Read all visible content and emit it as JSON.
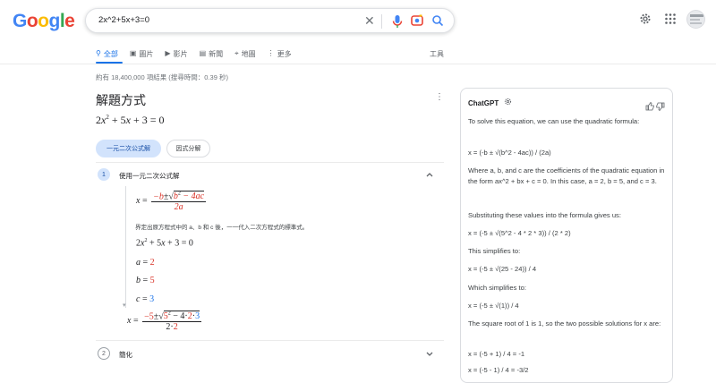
{
  "header": {
    "logo_text": "Google",
    "logo_colors": [
      "#4285F4",
      "#EA4335",
      "#FBBC05",
      "#4285F4",
      "#34A853",
      "#EA4335"
    ],
    "search_query": "2x^2+5x+3=0",
    "icons": [
      "clear-icon",
      "mic-icon",
      "lens-icon",
      "search-icon",
      "settings-icon",
      "apps-icon",
      "avatar"
    ]
  },
  "tabs": [
    {
      "label": "全部",
      "icon": "search-icon",
      "active": true
    },
    {
      "label": "圖片",
      "icon": "image-icon",
      "active": false
    },
    {
      "label": "影片",
      "icon": "video-icon",
      "active": false
    },
    {
      "label": "新聞",
      "icon": "news-icon",
      "active": false
    },
    {
      "label": "地圖",
      "icon": "map-pin-icon",
      "active": false
    },
    {
      "label": "更多",
      "icon": "more-icon",
      "active": false
    }
  ],
  "tools_label": "工具",
  "stats": "約有 18,400,000 項結果 (搜尋時間：0.39 秒)",
  "solver": {
    "title": "解題方式",
    "equation": {
      "a": "2",
      "b": "5",
      "c": "3"
    },
    "chips": [
      "一元二次公式解",
      "因式分解"
    ],
    "step1": {
      "num": "1",
      "label": "使用一元二次公式解"
    },
    "step2": {
      "num": "2",
      "label": "簡化"
    },
    "formula": {
      "lhs": "x",
      "num_neg_b": "−b",
      "pm": "±",
      "radicand": "b",
      "exp": "2",
      "minus4ac": " − 4ac",
      "den": "2a"
    },
    "note": "界定出原方程式中的 a、b 和 c 後，一一代入二次方程式的標準式。",
    "vals": {
      "a": "2",
      "b": "5",
      "c": "3"
    },
    "subst": {
      "neg_b": "−5",
      "pm": "±",
      "b": "5",
      "exp": "2",
      "four": " − 4·",
      "a": "2",
      "dot": "·",
      "c": "3",
      "den_two": "2·",
      "den_a": "2"
    }
  },
  "chatgpt": {
    "title": "ChatGPT",
    "paragraphs": [
      "To solve this equation, we can use the quadratic formula:",
      "x = (-b ± √(b^2 - 4ac)) / (2a)",
      "Where a, b, and c are the coefficients of the quadratic equation in the form ax^2 + bx + c = 0. In this case, a = 2, b = 5, and c = 3.",
      "Substituting these values into the formula gives us:",
      "x = (-5 ± √(5^2 - 4 * 2 * 3)) / (2 * 2)",
      "This simplifies to:",
      "x = (-5 ± √(25 - 24)) / 4",
      "Which simplifies to:",
      "x = (-5 ± √(1)) / 4",
      "The square root of 1 is 1, so the two possible solutions for x are:",
      "x = (-5 + 1) / 4 = -1",
      "x = (-5 - 1) / 4 = -3/2"
    ]
  }
}
